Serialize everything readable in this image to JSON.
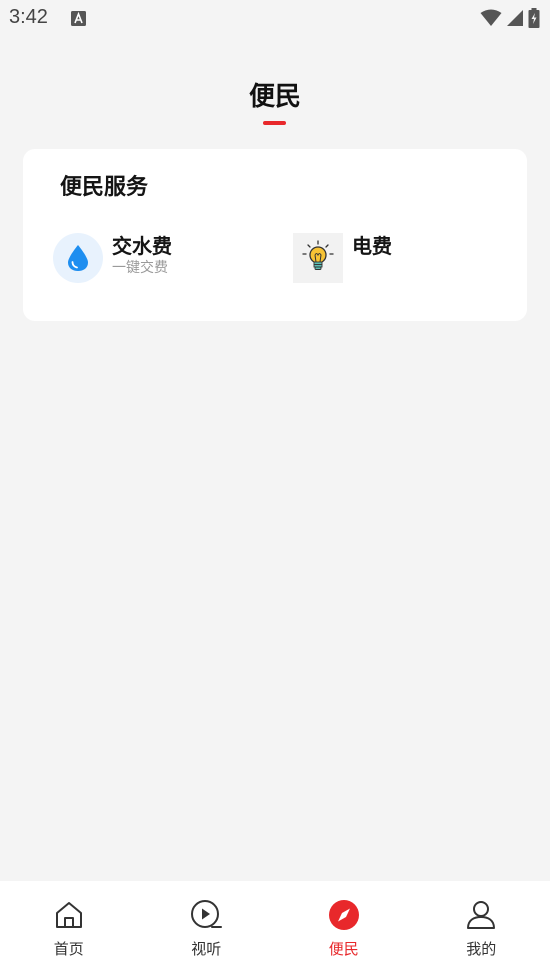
{
  "status_bar": {
    "time": "3:42"
  },
  "header": {
    "title": "便民"
  },
  "card": {
    "title": "便民服务",
    "services": [
      {
        "name": "交水费",
        "subtitle": "一键交费",
        "icon": "water-drop-icon"
      },
      {
        "name": "电费",
        "subtitle": "",
        "icon": "light-bulb-icon"
      }
    ]
  },
  "bottom_nav": {
    "items": [
      {
        "label": "首页",
        "icon": "home-icon",
        "active": false
      },
      {
        "label": "视听",
        "icon": "play-circle-icon",
        "active": false
      },
      {
        "label": "便民",
        "icon": "compass-icon",
        "active": true
      },
      {
        "label": "我的",
        "icon": "user-icon",
        "active": false
      }
    ]
  },
  "colors": {
    "accent": "#e8282b",
    "background": "#f4f4f4",
    "card": "#ffffff",
    "water_blue": "#1e8ef0"
  }
}
